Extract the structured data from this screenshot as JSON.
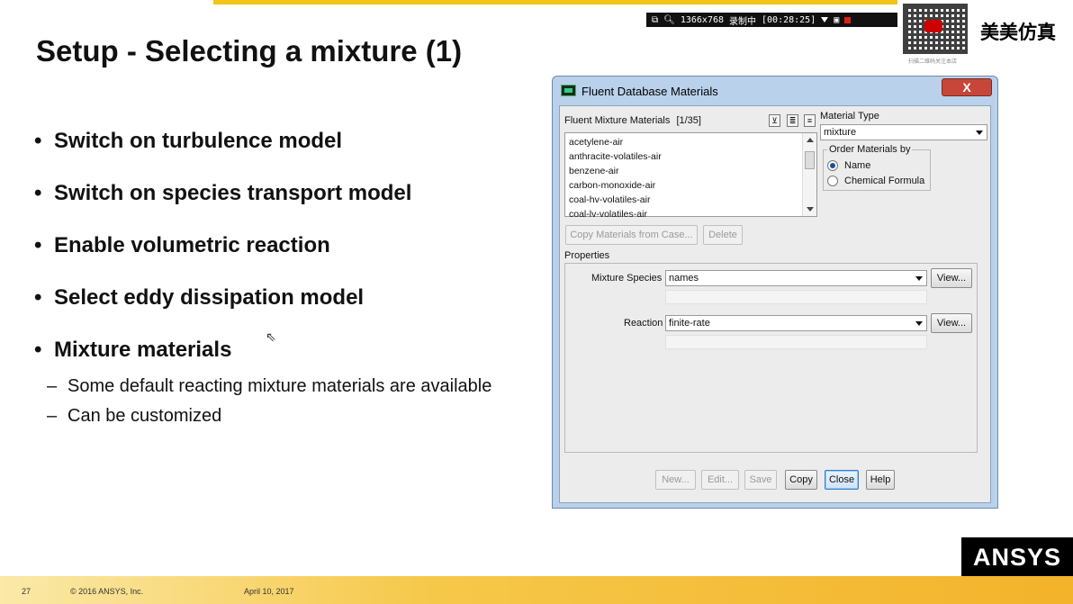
{
  "slide": {
    "title": "Setup - Selecting a mixture (1)",
    "bullets": [
      "Switch on turbulence model",
      "Switch on species transport model",
      "Enable volumetric reaction",
      "Select eddy dissipation model",
      "Mixture materials"
    ],
    "sub_bullets": [
      "Some default reacting mixture  materials are available",
      "Can be customized"
    ],
    "dash": "–",
    "page_number": "27",
    "copyright": "© 2016 ANSYS, Inc.",
    "date": "April 10, 2017",
    "logo": "ANSYS"
  },
  "recorder": {
    "resolution": "1366x768",
    "status": "录制中",
    "time": "[00:28:25]"
  },
  "watermark": {
    "brand": "美美仿真",
    "caption": "扫描二维码关注本店"
  },
  "dialog": {
    "title": "Fluent Database Materials",
    "close_label": "X",
    "list_label": "Fluent Mixture Materials",
    "list_count": "[1/35]",
    "list_items": [
      "acetylene-air",
      "anthracite-volatiles-air",
      "benzene-air",
      "carbon-monoxide-air",
      "coal-hv-volatiles-air",
      "coal-lv-volatiles-air"
    ],
    "material_type_label": "Material Type",
    "material_type_value": "mixture",
    "order_label": "Order Materials by",
    "order_options": [
      "Name",
      "Chemical Formula"
    ],
    "order_selected": "Name",
    "copy_from_case_label": "Copy Materials from Case...",
    "delete_label": "Delete",
    "properties_label": "Properties",
    "mixture_species_label": "Mixture Species",
    "mixture_species_value": "names",
    "reaction_label": "Reaction",
    "reaction_value": "finite-rate",
    "view_label": "View...",
    "buttons": {
      "new": "New...",
      "edit": "Edit...",
      "save": "Save",
      "copy": "Copy",
      "close": "Close",
      "help": "Help"
    }
  }
}
